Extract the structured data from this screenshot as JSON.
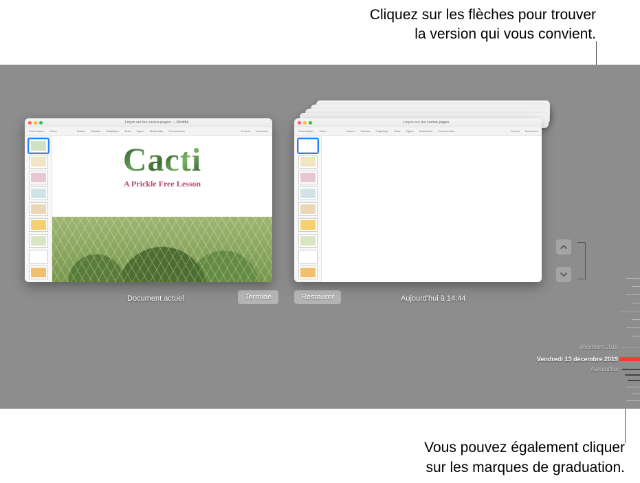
{
  "captions": {
    "top_line1": "Cliquez sur les flèches pour trouver",
    "top_line2": "la version qui vous convient.",
    "bottom_line1": "Vous pouvez également cliquer",
    "bottom_line2": "sur les marques de graduation."
  },
  "left_window": {
    "title": "Leçon sur les cactus.pages — Modifié",
    "slide_title": "Cacti",
    "slide_subtitle": "A Prickle Free Lesson",
    "footer_label": "Document actuel",
    "button": "Terminé"
  },
  "right_window": {
    "title": "Leçon sur les cactus.pages",
    "footer_label": "Aujourd'hui à  14:44",
    "button": "Restaurer"
  },
  "toolbar_items": [
    "Présentation",
    "Zoom",
    "Insérer",
    "Tableau",
    "Graphique",
    "Texte",
    "Figure",
    "Multimédia",
    "Commentaire",
    "Format",
    "Document"
  ],
  "timeline": {
    "label_month": "décembre 2019",
    "label_selected": "Vendredi 13 décembre 2019",
    "label_today": "Aujourd'hui"
  },
  "nav": {
    "up_name": "chevron-up-icon",
    "down_name": "chevron-down-icon"
  }
}
